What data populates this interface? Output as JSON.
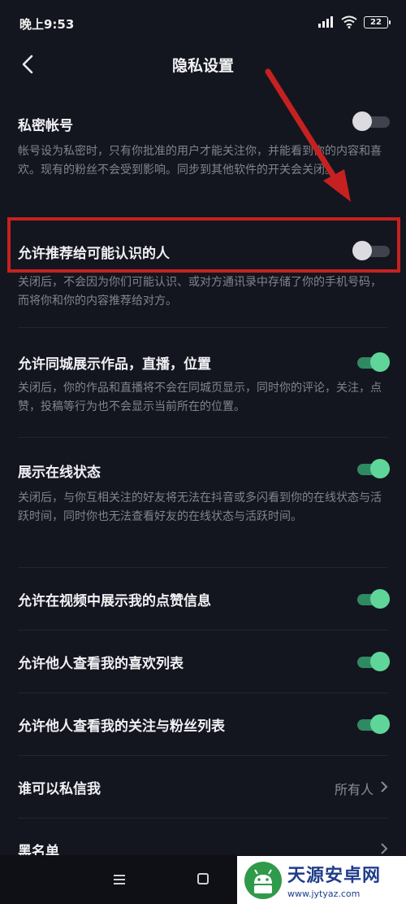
{
  "status_bar": {
    "time": "晚上9:53",
    "battery": "22"
  },
  "nav": {
    "title": "隐私设置"
  },
  "settings": {
    "private_account": {
      "label": "私密帐号",
      "desc": "帐号设为私密时，只有你批准的用户才能关注你，并能看到你的内容和喜欢。现有的粉丝不会受到影响。同步到其他软件的开关会关闭。",
      "state": "off"
    },
    "recommend_known": {
      "label": "允许推荐给可能认识的人",
      "desc": "关闭后，不会因为你们可能认识、或对方通讯录中存储了你的手机号码，而将你和你的内容推荐给对方。",
      "state": "off"
    },
    "same_city": {
      "label": "允许同城展示作品，直播，位置",
      "desc": "关闭后，你的作品和直播将不会在同城页显示，同时你的评论，关注，点赞，投稿等行为也不会显示当前所在的位置。",
      "state": "on"
    },
    "online_status": {
      "label": "展示在线状态",
      "desc": "关闭后，与你互相关注的好友将无法在抖音或多闪看到你的在线状态与活跃时间，同时你也无法查看好友的在线状态与活跃时间。",
      "state": "on"
    },
    "show_likes_in_video": {
      "label": "允许在视频中展示我的点赞信息",
      "state": "on"
    },
    "likes_list": {
      "label": "允许他人查看我的喜欢列表",
      "state": "on"
    },
    "follow_fans_list": {
      "label": "允许他人查看我的关注与粉丝列表",
      "state": "on"
    },
    "who_can_message": {
      "label": "谁可以私信我",
      "value": "所有人"
    },
    "blacklist": {
      "label": "黑名单"
    }
  },
  "colors": {
    "accent_on": "#5fd59a",
    "highlight": "#c62121",
    "background": "#14161f"
  },
  "watermark": {
    "name": "天源安卓网",
    "url": "www.jytyaz.com"
  }
}
